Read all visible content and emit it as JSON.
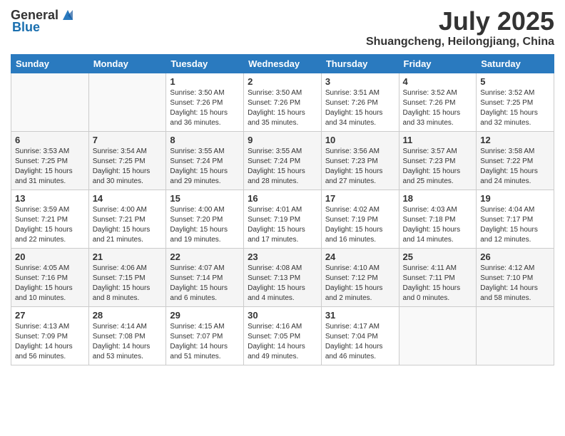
{
  "header": {
    "logo_general": "General",
    "logo_blue": "Blue",
    "month": "July 2025",
    "location": "Shuangcheng, Heilongjiang, China"
  },
  "days_of_week": [
    "Sunday",
    "Monday",
    "Tuesday",
    "Wednesday",
    "Thursday",
    "Friday",
    "Saturday"
  ],
  "weeks": [
    [
      {
        "day": "",
        "info": ""
      },
      {
        "day": "",
        "info": ""
      },
      {
        "day": "1",
        "info": "Sunrise: 3:50 AM\nSunset: 7:26 PM\nDaylight: 15 hours and 36 minutes."
      },
      {
        "day": "2",
        "info": "Sunrise: 3:50 AM\nSunset: 7:26 PM\nDaylight: 15 hours and 35 minutes."
      },
      {
        "day": "3",
        "info": "Sunrise: 3:51 AM\nSunset: 7:26 PM\nDaylight: 15 hours and 34 minutes."
      },
      {
        "day": "4",
        "info": "Sunrise: 3:52 AM\nSunset: 7:26 PM\nDaylight: 15 hours and 33 minutes."
      },
      {
        "day": "5",
        "info": "Sunrise: 3:52 AM\nSunset: 7:25 PM\nDaylight: 15 hours and 32 minutes."
      }
    ],
    [
      {
        "day": "6",
        "info": "Sunrise: 3:53 AM\nSunset: 7:25 PM\nDaylight: 15 hours and 31 minutes."
      },
      {
        "day": "7",
        "info": "Sunrise: 3:54 AM\nSunset: 7:25 PM\nDaylight: 15 hours and 30 minutes."
      },
      {
        "day": "8",
        "info": "Sunrise: 3:55 AM\nSunset: 7:24 PM\nDaylight: 15 hours and 29 minutes."
      },
      {
        "day": "9",
        "info": "Sunrise: 3:55 AM\nSunset: 7:24 PM\nDaylight: 15 hours and 28 minutes."
      },
      {
        "day": "10",
        "info": "Sunrise: 3:56 AM\nSunset: 7:23 PM\nDaylight: 15 hours and 27 minutes."
      },
      {
        "day": "11",
        "info": "Sunrise: 3:57 AM\nSunset: 7:23 PM\nDaylight: 15 hours and 25 minutes."
      },
      {
        "day": "12",
        "info": "Sunrise: 3:58 AM\nSunset: 7:22 PM\nDaylight: 15 hours and 24 minutes."
      }
    ],
    [
      {
        "day": "13",
        "info": "Sunrise: 3:59 AM\nSunset: 7:21 PM\nDaylight: 15 hours and 22 minutes."
      },
      {
        "day": "14",
        "info": "Sunrise: 4:00 AM\nSunset: 7:21 PM\nDaylight: 15 hours and 21 minutes."
      },
      {
        "day": "15",
        "info": "Sunrise: 4:00 AM\nSunset: 7:20 PM\nDaylight: 15 hours and 19 minutes."
      },
      {
        "day": "16",
        "info": "Sunrise: 4:01 AM\nSunset: 7:19 PM\nDaylight: 15 hours and 17 minutes."
      },
      {
        "day": "17",
        "info": "Sunrise: 4:02 AM\nSunset: 7:19 PM\nDaylight: 15 hours and 16 minutes."
      },
      {
        "day": "18",
        "info": "Sunrise: 4:03 AM\nSunset: 7:18 PM\nDaylight: 15 hours and 14 minutes."
      },
      {
        "day": "19",
        "info": "Sunrise: 4:04 AM\nSunset: 7:17 PM\nDaylight: 15 hours and 12 minutes."
      }
    ],
    [
      {
        "day": "20",
        "info": "Sunrise: 4:05 AM\nSunset: 7:16 PM\nDaylight: 15 hours and 10 minutes."
      },
      {
        "day": "21",
        "info": "Sunrise: 4:06 AM\nSunset: 7:15 PM\nDaylight: 15 hours and 8 minutes."
      },
      {
        "day": "22",
        "info": "Sunrise: 4:07 AM\nSunset: 7:14 PM\nDaylight: 15 hours and 6 minutes."
      },
      {
        "day": "23",
        "info": "Sunrise: 4:08 AM\nSunset: 7:13 PM\nDaylight: 15 hours and 4 minutes."
      },
      {
        "day": "24",
        "info": "Sunrise: 4:10 AM\nSunset: 7:12 PM\nDaylight: 15 hours and 2 minutes."
      },
      {
        "day": "25",
        "info": "Sunrise: 4:11 AM\nSunset: 7:11 PM\nDaylight: 15 hours and 0 minutes."
      },
      {
        "day": "26",
        "info": "Sunrise: 4:12 AM\nSunset: 7:10 PM\nDaylight: 14 hours and 58 minutes."
      }
    ],
    [
      {
        "day": "27",
        "info": "Sunrise: 4:13 AM\nSunset: 7:09 PM\nDaylight: 14 hours and 56 minutes."
      },
      {
        "day": "28",
        "info": "Sunrise: 4:14 AM\nSunset: 7:08 PM\nDaylight: 14 hours and 53 minutes."
      },
      {
        "day": "29",
        "info": "Sunrise: 4:15 AM\nSunset: 7:07 PM\nDaylight: 14 hours and 51 minutes."
      },
      {
        "day": "30",
        "info": "Sunrise: 4:16 AM\nSunset: 7:05 PM\nDaylight: 14 hours and 49 minutes."
      },
      {
        "day": "31",
        "info": "Sunrise: 4:17 AM\nSunset: 7:04 PM\nDaylight: 14 hours and 46 minutes."
      },
      {
        "day": "",
        "info": ""
      },
      {
        "day": "",
        "info": ""
      }
    ]
  ]
}
